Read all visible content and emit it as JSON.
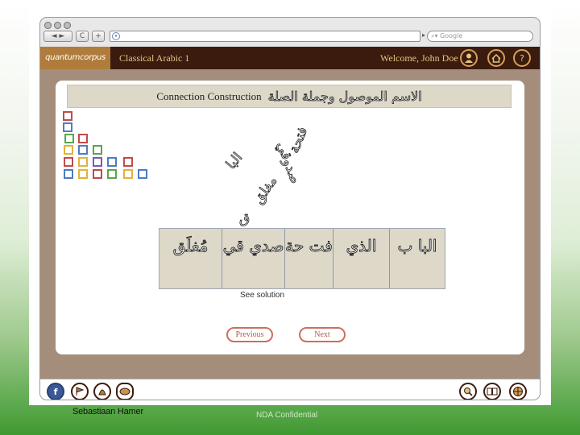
{
  "browser": {
    "search_placeholder": "Google",
    "back_fwd_label": "◄ ►",
    "reload_label": "C",
    "add_label": "+",
    "url_icon": "globe-icon",
    "search_icon": "search-icon"
  },
  "app": {
    "logo": "quantumcorpus",
    "course_title": "Classical Arabic 1",
    "welcome": "Welcome, John Doe",
    "header_icons": [
      "user-icon",
      "home-icon",
      "help-icon"
    ],
    "help_glyph": "?"
  },
  "lesson": {
    "title_en": "Connection Construction",
    "title_ar": "الاسم الموصول وجملة الصلة",
    "scattered_fragments": [
      "فتحة",
      "البا",
      "صدوقي",
      "مغلق",
      "ق"
    ],
    "cards": [
      "البا ب",
      "الذي",
      "فت حة",
      "صدي قي",
      "مُغلَق"
    ],
    "see_solution": "See solution",
    "prev_label": "Previous",
    "next_label": "Next"
  },
  "bottom_bar": {
    "left_icons": [
      "facebook-icon",
      "flag-icon",
      "stamp-icon",
      "bread-icon"
    ],
    "right_icons": [
      "magnifier-icon",
      "book-icon",
      "compass-icon"
    ],
    "facebook_glyph": "f"
  },
  "footer": {
    "author": "Sebastiaan Hamer",
    "confidential": "NDA Confidential"
  },
  "colors": {
    "appbar": "#3c1b0f",
    "logo_bg": "#b07c3b",
    "gold_text": "#e1c47e",
    "stage_bg": "#a48e7b",
    "card_bg": "#ddd8c8",
    "pill_border": "#cc6f5e"
  }
}
